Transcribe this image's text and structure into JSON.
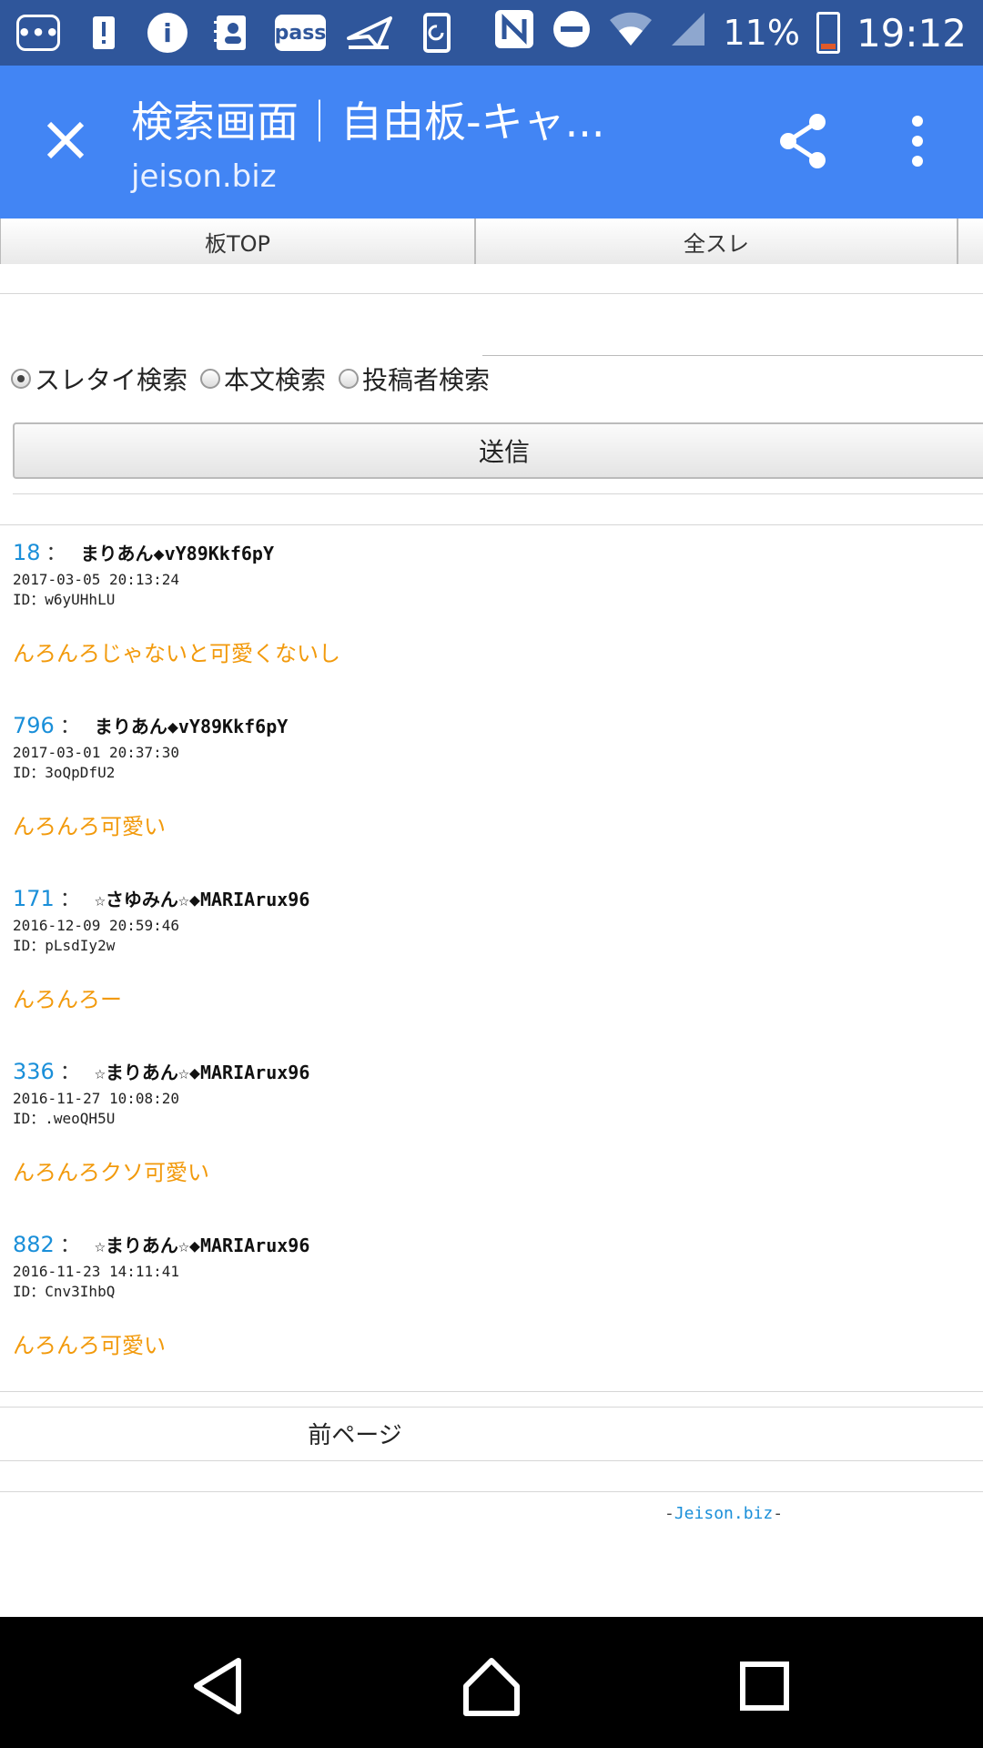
{
  "status_bar": {
    "pass_label": "pass",
    "battery": "11%",
    "time": "19:12"
  },
  "app_bar": {
    "title": "検索画面｜自由板-キャ...",
    "domain": "jeison.biz"
  },
  "tabs": [
    {
      "label": "板TOP"
    },
    {
      "label": "全スレ"
    }
  ],
  "search": {
    "options": [
      {
        "label": "スレタイ検索",
        "selected": true
      },
      {
        "label": "本文検索",
        "selected": false
      },
      {
        "label": "投稿者検索",
        "selected": false
      }
    ],
    "submit_label": "送信"
  },
  "posts": [
    {
      "number": "18",
      "sep": "：",
      "author": "まりあん◆vY89Kkf6pY",
      "date": "2017-03-05 20:13:24",
      "id": "ID：w6yUHhLU",
      "body": "んろんろじゃないと可愛くないし"
    },
    {
      "number": "796",
      "sep": "：",
      "author": "まりあん◆vY89Kkf6pY",
      "date": "2017-03-01 20:37:30",
      "id": "ID：3oQpDfU2",
      "body": "んろんろ可愛い"
    },
    {
      "number": "171",
      "sep": "：",
      "author": "☆さゆみん☆◆MARIArux96",
      "date": "2016-12-09 20:59:46",
      "id": "ID：pLsdIy2w",
      "body": "んろんろー"
    },
    {
      "number": "336",
      "sep": "：",
      "author": "☆まりあん☆◆MARIArux96",
      "date": "2016-11-27 10:08:20",
      "id": "ID：.weoQH5U",
      "body": "んろんろクソ可愛い"
    },
    {
      "number": "882",
      "sep": "：",
      "author": "☆まりあん☆◆MARIArux96",
      "date": "2016-11-23 14:11:41",
      "id": "ID：Cnv3IhbQ",
      "body": "んろんろ可愛い"
    }
  ],
  "pagination": {
    "prev_label": "前ページ"
  },
  "footer": {
    "prefix": "-",
    "link": "Jeison.biz",
    "suffix": "-"
  },
  "colors": {
    "status_bar": "#2f569b",
    "app_bar": "#4285f4",
    "post_number": "#1a8fd9",
    "post_body": "#f29a0c"
  },
  "icons": [
    "message-icon",
    "alert-icon",
    "info-icon",
    "contacts-icon",
    "pass-icon",
    "send-icon",
    "sync-icon",
    "nfc-icon",
    "dnd-icon",
    "wifi-icon",
    "signal-icon",
    "battery-icon",
    "close-icon",
    "share-icon",
    "more-vert-icon",
    "back-icon",
    "home-icon",
    "recents-icon"
  ]
}
